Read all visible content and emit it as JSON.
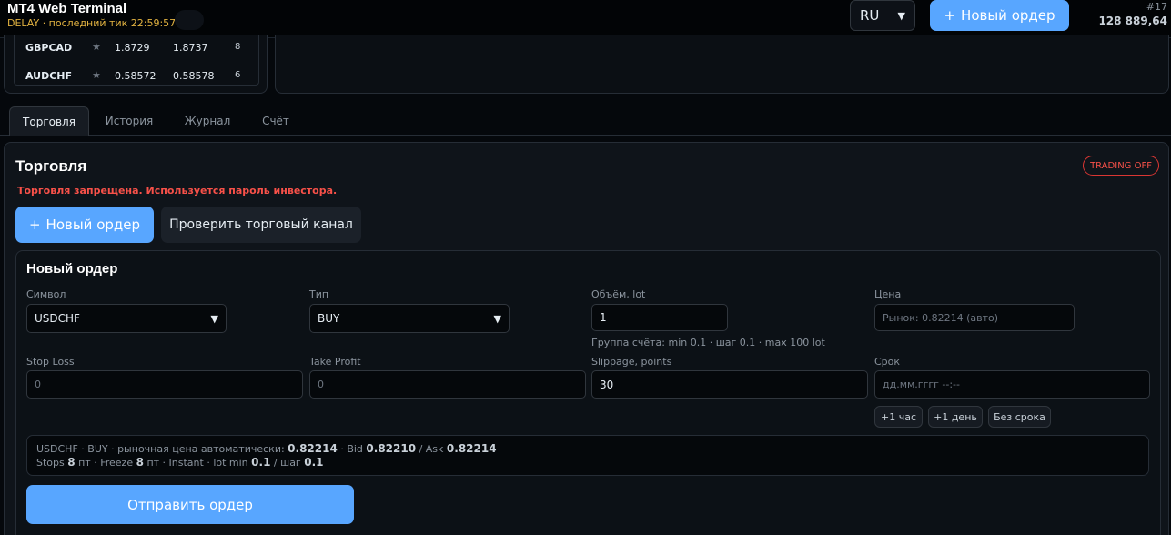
{
  "header": {
    "title": "MT4 Web Terminal",
    "status": "DELAY · последний тик 22:59:57",
    "lang": "RU",
    "new_order": "Новый ордер",
    "account_number": "#17",
    "balance": "128 889,64"
  },
  "quotes": [
    {
      "symbol": "GBPCAD",
      "bid": "1.8729",
      "ask": "1.8737",
      "spread": "8"
    },
    {
      "symbol": "AUDCHF",
      "bid": "0.58572",
      "ask": "0.58578",
      "spread": "6"
    }
  ],
  "tabs": [
    {
      "label": "Торговля",
      "active": true
    },
    {
      "label": "История",
      "active": false
    },
    {
      "label": "Журнал",
      "active": false
    },
    {
      "label": "Счёт",
      "active": false
    }
  ],
  "trade": {
    "title": "Торговля",
    "badge": "TRADING OFF",
    "warning": "Торговля запрещена. Используется пароль инвестора.",
    "new_order": "Новый ордер",
    "check_channel": "Проверить торговый канал"
  },
  "order_form": {
    "title": "Новый ордер",
    "symbol": {
      "label": "Символ",
      "value": "USDCHF"
    },
    "type": {
      "label": "Тип",
      "value": "BUY"
    },
    "volume": {
      "label": "Объём, lot",
      "value": "1",
      "hint": "Группа счёта: min 0.1 · шаг 0.1 · max 100 lot"
    },
    "price": {
      "label": "Цена",
      "placeholder": "Рынок: 0.82214 (авто)"
    },
    "stop_loss": {
      "label": "Stop Loss",
      "placeholder": "0"
    },
    "take_profit": {
      "label": "Take Profit",
      "placeholder": "0"
    },
    "slippage": {
      "label": "Slippage, points",
      "value": "30"
    },
    "expiry": {
      "label": "Срок",
      "placeholder": "дд.мм.гггг --:--"
    },
    "quick": [
      "+1 час",
      "+1 день",
      "Без срока"
    ],
    "summary": {
      "prefix": "USDCHF · BUY · рыночная цена автоматически:",
      "price": "0.82214",
      "bid_label": "· Bid",
      "bid": "0.82210",
      "ask_label": "/ Ask",
      "ask": "0.82214",
      "stops_label": "Stops",
      "stops": "8",
      "freeze_label": "пт · Freeze",
      "freeze": "8",
      "mode_label": "пт · Instant · lot min",
      "lot_min": "0.1",
      "step_label": "/ шаг",
      "lot_step": "0.1"
    },
    "submit": "Отправить ордер"
  },
  "icons": {
    "plus": "plus-icon",
    "chevron": "chevron-down-icon",
    "star": "star-icon"
  },
  "colors": {
    "accent": "#58a6ff",
    "danger": "#f85149",
    "warning": "#e3b341"
  }
}
